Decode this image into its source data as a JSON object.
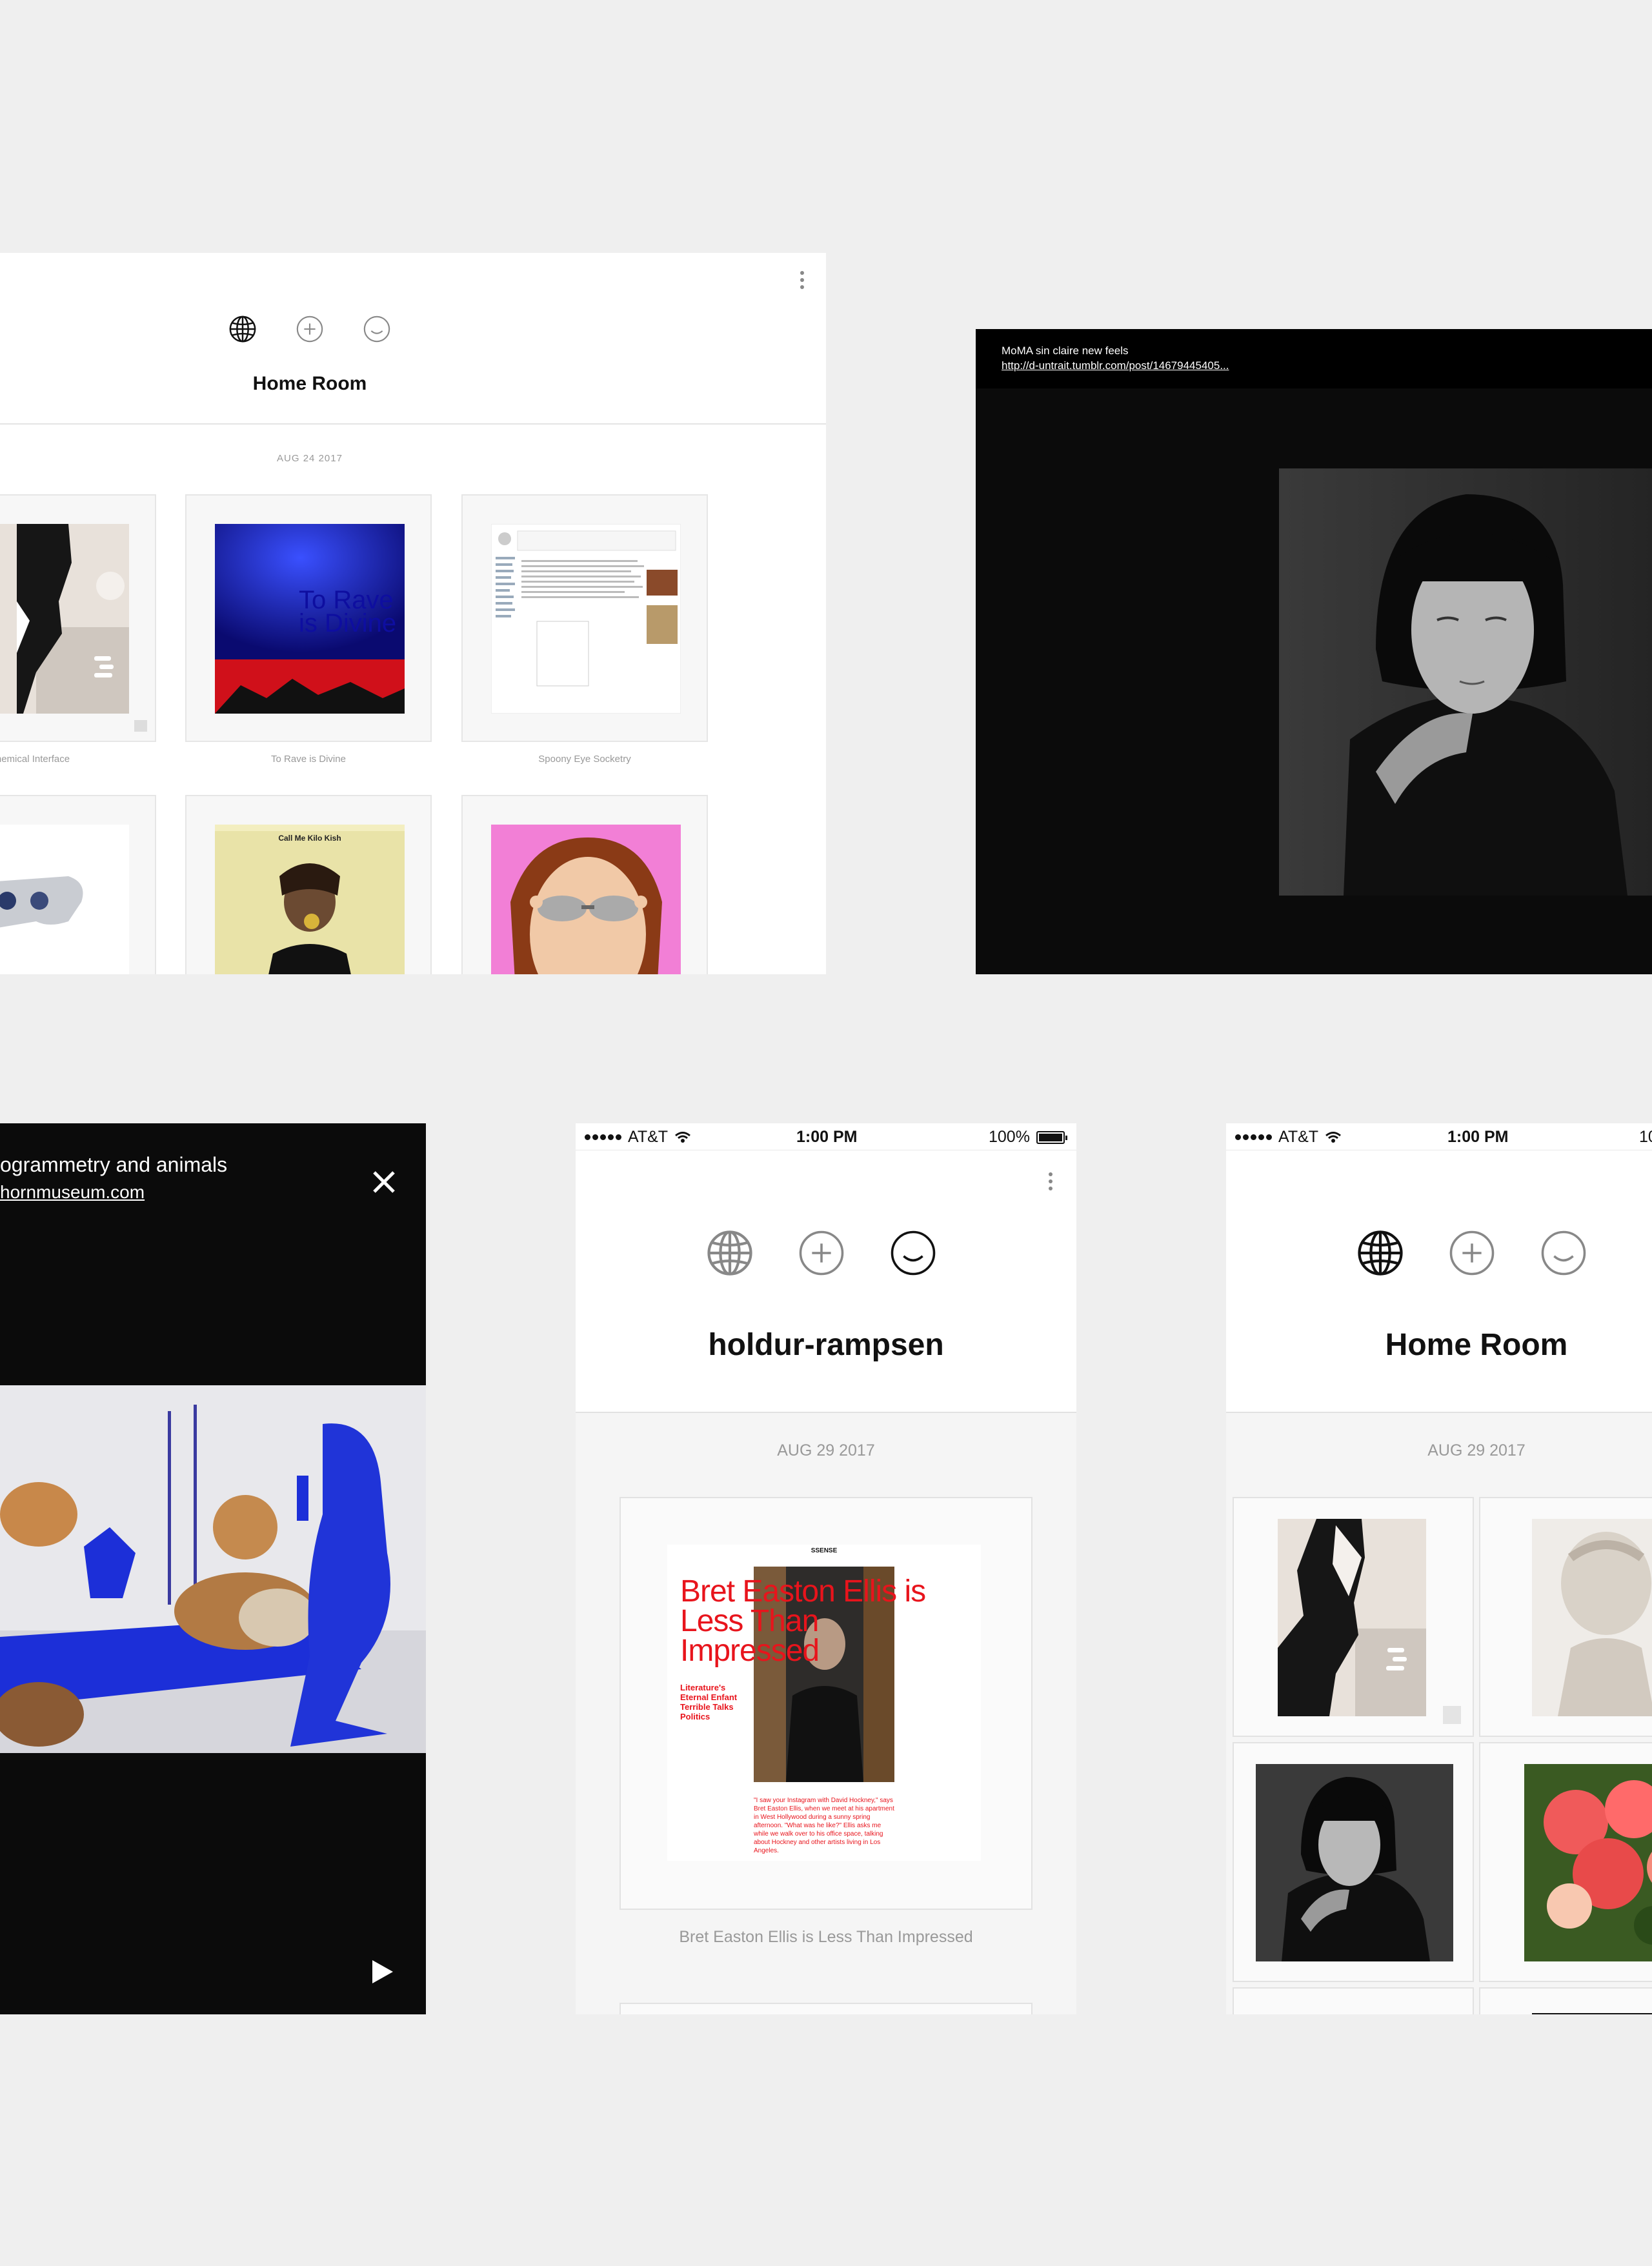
{
  "panel_desktop": {
    "title": "Home Room",
    "date": "AUG 24 2017",
    "tiles": [
      {
        "caption": "hemical Interface"
      },
      {
        "caption": "To Rave is Divine",
        "overlay_text": "To Rave is Divine"
      },
      {
        "caption": "Spoony Eye Socketry"
      },
      {
        "caption": ""
      },
      {
        "caption": "",
        "page_heading": "Call Me Kilo Kish"
      },
      {
        "caption": ""
      }
    ],
    "icons": [
      "globe-icon",
      "plus-circle-icon",
      "smiley-icon",
      "kebab-menu-icon"
    ]
  },
  "panel_image_viewer": {
    "title": "MoMA sin claire new feels",
    "link": "http://d-untrait.tumblr.com/post/14679445405..."
  },
  "panel_video_viewer": {
    "title": "ogrammetry and animals",
    "link": "hornmuseum.com",
    "icons": [
      "close-icon",
      "play-icon"
    ]
  },
  "phone_holdur": {
    "carrier": "AT&T",
    "time": "1:00 PM",
    "battery": "100%",
    "title": "holdur-rampsen",
    "date": "AUG 29 2017",
    "post": {
      "site": "SSENSE",
      "headline": "Bret Easton Ellis is Less Than Impressed",
      "sidebar": "Literature's Eternal Enfant Terrible Talks Politics",
      "quote": "\"I saw your Instagram with David Hockney,\" says Bret Easton Ellis, when we meet at his apartment in West Hollywood during a sunny spring afternoon. \"What was he like?\" Ellis asks me while we walk over to his office space, talking about Hockney and other artists living in Los Angeles."
    },
    "caption": "Bret Easton Ellis is Less Than Impressed"
  },
  "phone_home": {
    "carrier": "AT&T",
    "time": "1:00 PM",
    "battery": "10",
    "title": "Home Room",
    "date": "AUG 29 2017"
  },
  "colors": {
    "background": "#efefef",
    "accent_red": "#e8141c",
    "ssense_blue": "#1515d8",
    "klein_blue": "#1c2fd8"
  }
}
